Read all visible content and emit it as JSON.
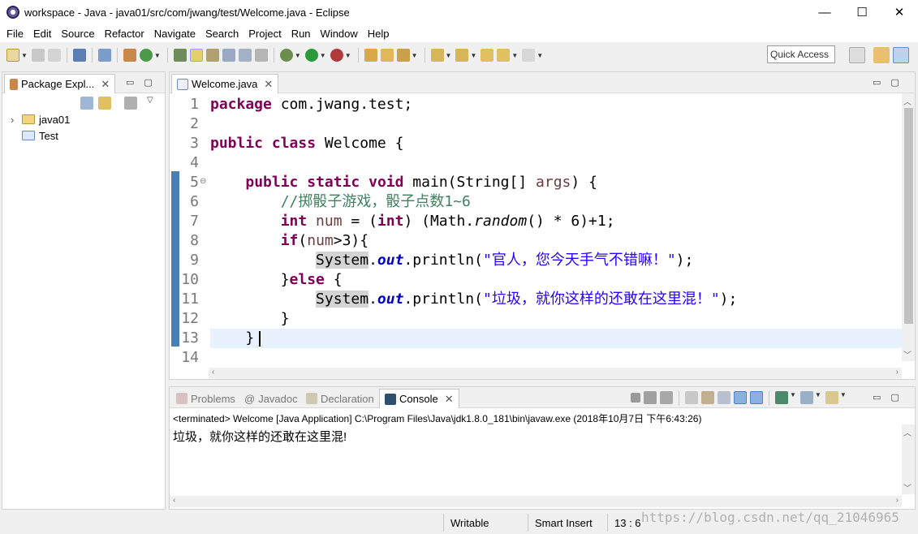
{
  "window": {
    "title": "workspace - Java - java01/src/com/jwang/test/Welcome.java - Eclipse",
    "minimize": "—",
    "maximize": "☐",
    "close": "✕"
  },
  "menu": [
    "File",
    "Edit",
    "Source",
    "Refactor",
    "Navigate",
    "Search",
    "Project",
    "Run",
    "Window",
    "Help"
  ],
  "toolbar": {
    "quick_access": "Quick Access"
  },
  "explorer": {
    "tab_label": "Package Expl...",
    "close": "✕",
    "items": [
      {
        "label": "java01",
        "expander": "›"
      },
      {
        "label": "Test",
        "expander": ""
      }
    ]
  },
  "editor": {
    "tab_label": "Welcome.java",
    "close": "✕",
    "line_numbers": [
      "1",
      "2",
      "3",
      "4",
      "5",
      "6",
      "7",
      "8",
      "9",
      "10",
      "11",
      "12",
      "13",
      "14"
    ],
    "fold_marker": "⊖",
    "lines": {
      "l1_kw": "package",
      "l1_rest": " com.jwang.test;",
      "l3_kw1": "public",
      "l3_kw2": "class",
      "l3_rest": " Welcome {",
      "l5_indent": "    ",
      "l5_kw1": "public",
      "l5_kw2": "static",
      "l5_kw3": "void",
      "l5_name": " main(String[] ",
      "l5_arg": "args",
      "l5_rest": ") {",
      "l6_comment": "        //掷骰子游戏，骰子点数1~6",
      "l7_indent": "        ",
      "l7_kw": "int",
      "l7_var": " num",
      "l7_a": " = (",
      "l7_kw2": "int",
      "l7_b": ") (Math.",
      "l7_m": "random",
      "l7_c": "() * 6)+1;",
      "l8_indent": "        ",
      "l8_kw": "if",
      "l8_a": "(",
      "l8_var": "num",
      "l8_b": ">3){",
      "l9_indent": "            ",
      "l9_sys": "System",
      "l9_dot": ".",
      "l9_out": "out",
      "l9_a": ".println(",
      "l9_str": "\"官人，您今天手气不错嘛！\"",
      "l9_b": ");",
      "l10_a": "        }",
      "l10_kw": "else",
      "l10_b": " {",
      "l11_indent": "            ",
      "l11_sys": "System",
      "l11_dot": ".",
      "l11_out": "out",
      "l11_a": ".println(",
      "l11_str": "\"垃圾，就你这样的还敢在这里混！\"",
      "l11_b": ");",
      "l12": "        }",
      "l13": "    }"
    },
    "scroll_up": "︿",
    "scroll_down": "﹀",
    "scroll_left": "‹",
    "scroll_right": "›"
  },
  "bottom_tabs": [
    {
      "label": "Problems"
    },
    {
      "label": "Javadoc",
      "prefix": "@"
    },
    {
      "label": "Declaration"
    },
    {
      "label": "Console",
      "close": "✕"
    }
  ],
  "console": {
    "info": "<terminated> Welcome [Java Application] C:\\Program Files\\Java\\jdk1.8.0_181\\bin\\javaw.exe (2018年10月7日 下午6:43:26)",
    "output": "垃圾，就你这样的还敢在这里混!"
  },
  "status": {
    "writable": "Writable",
    "insert_mode": "Smart Insert",
    "position": "13 : 6"
  },
  "watermark": "https://blog.csdn.net/qq_21046965",
  "colors": {
    "keyword": "#7f0055",
    "comment": "#3f7f5f",
    "string": "#2a00ff",
    "field": "#0000c0"
  }
}
